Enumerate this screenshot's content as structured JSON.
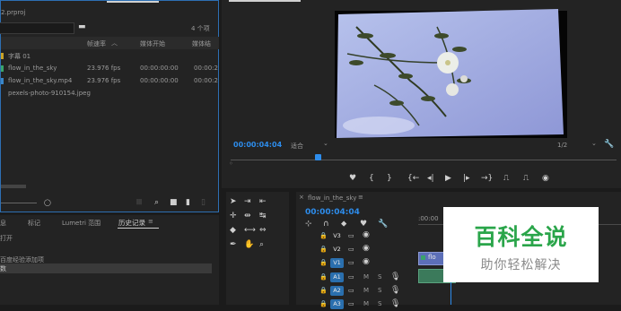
{
  "project": {
    "filename": "2.prproj",
    "item_count": "4 个项",
    "columns": [
      "帧速率",
      "媒体开始",
      "媒体结"
    ],
    "rows": [
      {
        "name": "字幕 01",
        "fps": "",
        "start": "",
        "end": ""
      },
      {
        "name": "flow_in_the_sky",
        "fps": "23.976 fps",
        "start": "00:00:00:00",
        "end": "00:00:2"
      },
      {
        "name": "flow_in_the_sky.mp4",
        "fps": "23.976 fps",
        "start": "00:00:00:00",
        "end": "00:00:2"
      },
      {
        "name": "pexels-photo-910154.jpeg",
        "fps": "",
        "start": "",
        "end": ""
      }
    ]
  },
  "history": {
    "tabs": [
      "息",
      "标记",
      "Lumetri 范围",
      "历史记录"
    ],
    "items": [
      "打开",
      "",
      "百度经验添加项",
      "数"
    ]
  },
  "program": {
    "timecode": "00:00:04:04",
    "fit": "适合",
    "resolution": "1/2"
  },
  "timeline": {
    "sequence_name": "flow_in_the_sky",
    "timecode": "00:00:04:04",
    "ruler_label": ":00:00",
    "tracks": [
      {
        "id": "V3",
        "type": "video"
      },
      {
        "id": "V2",
        "type": "video"
      },
      {
        "id": "V1",
        "type": "video"
      },
      {
        "id": "A1",
        "type": "audio"
      },
      {
        "id": "A2",
        "type": "audio"
      },
      {
        "id": "A3",
        "type": "audio"
      }
    ],
    "clip_label": "flo"
  },
  "watermark": {
    "title": "百科全说",
    "subtitle": "助你轻松解决"
  },
  "colors": {
    "accent": "#2d8ceb",
    "track_blue": "#2a6fae",
    "watermark_green": "#2aa54a"
  }
}
